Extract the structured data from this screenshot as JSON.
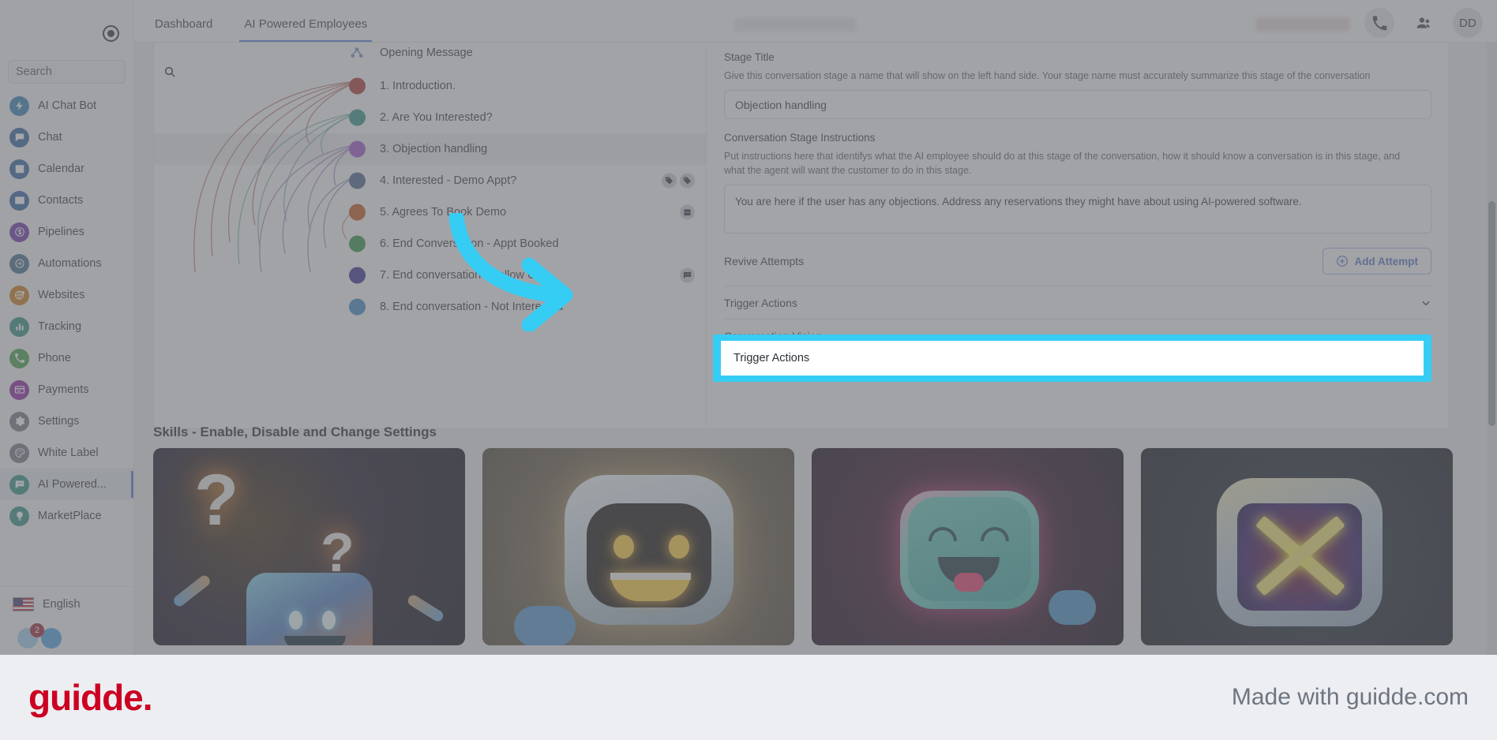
{
  "sidebar": {
    "collapse_icon": "collapse-circle-icon",
    "search": {
      "placeholder": "Search",
      "value": "",
      "icon": "search-icon"
    },
    "items": [
      {
        "label": "AI Chat Bot",
        "icon": "bolt-icon",
        "color": "#2f7fb5"
      },
      {
        "label": "Chat",
        "icon": "chat-icon",
        "color": "#2c5f9e"
      },
      {
        "label": "Calendar",
        "icon": "calendar-icon",
        "color": "#2c5f9e"
      },
      {
        "label": "Contacts",
        "icon": "contact-card-icon",
        "color": "#2c5f9e"
      },
      {
        "label": "Pipelines",
        "icon": "dollar-icon",
        "color": "#6b2fa8"
      },
      {
        "label": "Automations",
        "icon": "automation-icon",
        "color": "#3d6b86"
      },
      {
        "label": "Websites",
        "icon": "globe-icon",
        "color": "#c77a10"
      },
      {
        "label": "Tracking",
        "icon": "bar-chart-icon",
        "color": "#2e8f82"
      },
      {
        "label": "Phone",
        "icon": "phone-icon",
        "color": "#3f9e45"
      },
      {
        "label": "Payments",
        "icon": "credit-card-icon",
        "color": "#8a1f9e"
      },
      {
        "label": "Settings",
        "icon": "gear-icon",
        "color": "#6f767e"
      },
      {
        "label": "White Label",
        "icon": "palette-icon",
        "color": "#6f767e"
      },
      {
        "label": "AI Powered...",
        "icon": "ai-chat-icon",
        "color": "#2e8f82",
        "active": true
      },
      {
        "label": "MarketPlace",
        "icon": "lightbulb-icon",
        "color": "#2e8f82"
      }
    ],
    "language": {
      "label": "English",
      "flag": "us-flag-icon"
    },
    "notification_count": "2"
  },
  "topbar": {
    "tabs": [
      {
        "label": "Dashboard",
        "active": false
      },
      {
        "label": "AI Powered Employees",
        "active": true
      }
    ],
    "actions": [
      {
        "name": "phone-icon"
      },
      {
        "name": "people-icon"
      }
    ],
    "avatar_initials": "DD"
  },
  "builder": {
    "opening_message": "Opening Message",
    "stages": [
      {
        "label": "1. Introduction.",
        "color": "#a9342c",
        "icons": []
      },
      {
        "label": "2. Are You Interested?",
        "color": "#2f9183",
        "icons": []
      },
      {
        "label": "3. Objection handling",
        "color": "#9b51c4",
        "icons": [],
        "selected": true
      },
      {
        "label": "4. Interested - Demo Appt?",
        "color": "#44618a",
        "icons": [
          "tag-icon",
          "tag-icon"
        ]
      },
      {
        "label": "5. Agrees To Book Demo",
        "color": "#bf5316",
        "icons": [
          "calendar-icon"
        ]
      },
      {
        "label": "6. End Conversation - Appt Booked",
        "color": "#2f9040",
        "icons": []
      },
      {
        "label": "7. End conversation - Follow Up",
        "color": "#2d2a8f",
        "icons": [
          "message-icon"
        ]
      },
      {
        "label": "8. End conversation - Not Interested",
        "color": "#3a87c2",
        "icons": []
      }
    ],
    "detail": {
      "stage_title_label": "Stage Title",
      "stage_title_help": "Give this conversation stage a name that will show on the left hand side. Your stage name must accurately summarize this stage of the conversation",
      "stage_title_value": "Objection handling",
      "instructions_label": "Conversation Stage Instructions",
      "instructions_help": "Put instructions here that identifys what the AI employee should do at this stage of the conversation, how it should know a conversation is in this stage, and what the agent will want the customer to do in this stage.",
      "instructions_value": "You are here if the user has any objections.  Address any reservations they might have about using AI-powered software.",
      "revive_label": "Revive Attempts",
      "add_attempt_label": "Add Attempt",
      "accordions": [
        {
          "label": "Trigger Actions",
          "highlighted": true
        },
        {
          "label": "Conversation Vision",
          "highlighted": false
        }
      ]
    }
  },
  "skills": {
    "title": "Skills - Enable, Disable and Change Settings",
    "cards": [
      {
        "name": "skill-card-question-bot",
        "art": "question-robot"
      },
      {
        "name": "skill-card-happy-bot",
        "art": "happy-robot"
      },
      {
        "name": "skill-card-smiling-bot",
        "art": "smiling-robot"
      },
      {
        "name": "skill-card-x-bot",
        "art": "x-robot"
      }
    ]
  },
  "annotation": {
    "arrow_color": "#36cdf4",
    "highlight_color": "#36cdf4",
    "highlight_target": "Trigger Actions"
  },
  "footer": {
    "logo_text": "guidde.",
    "made_with": "Made with guidde.com"
  }
}
